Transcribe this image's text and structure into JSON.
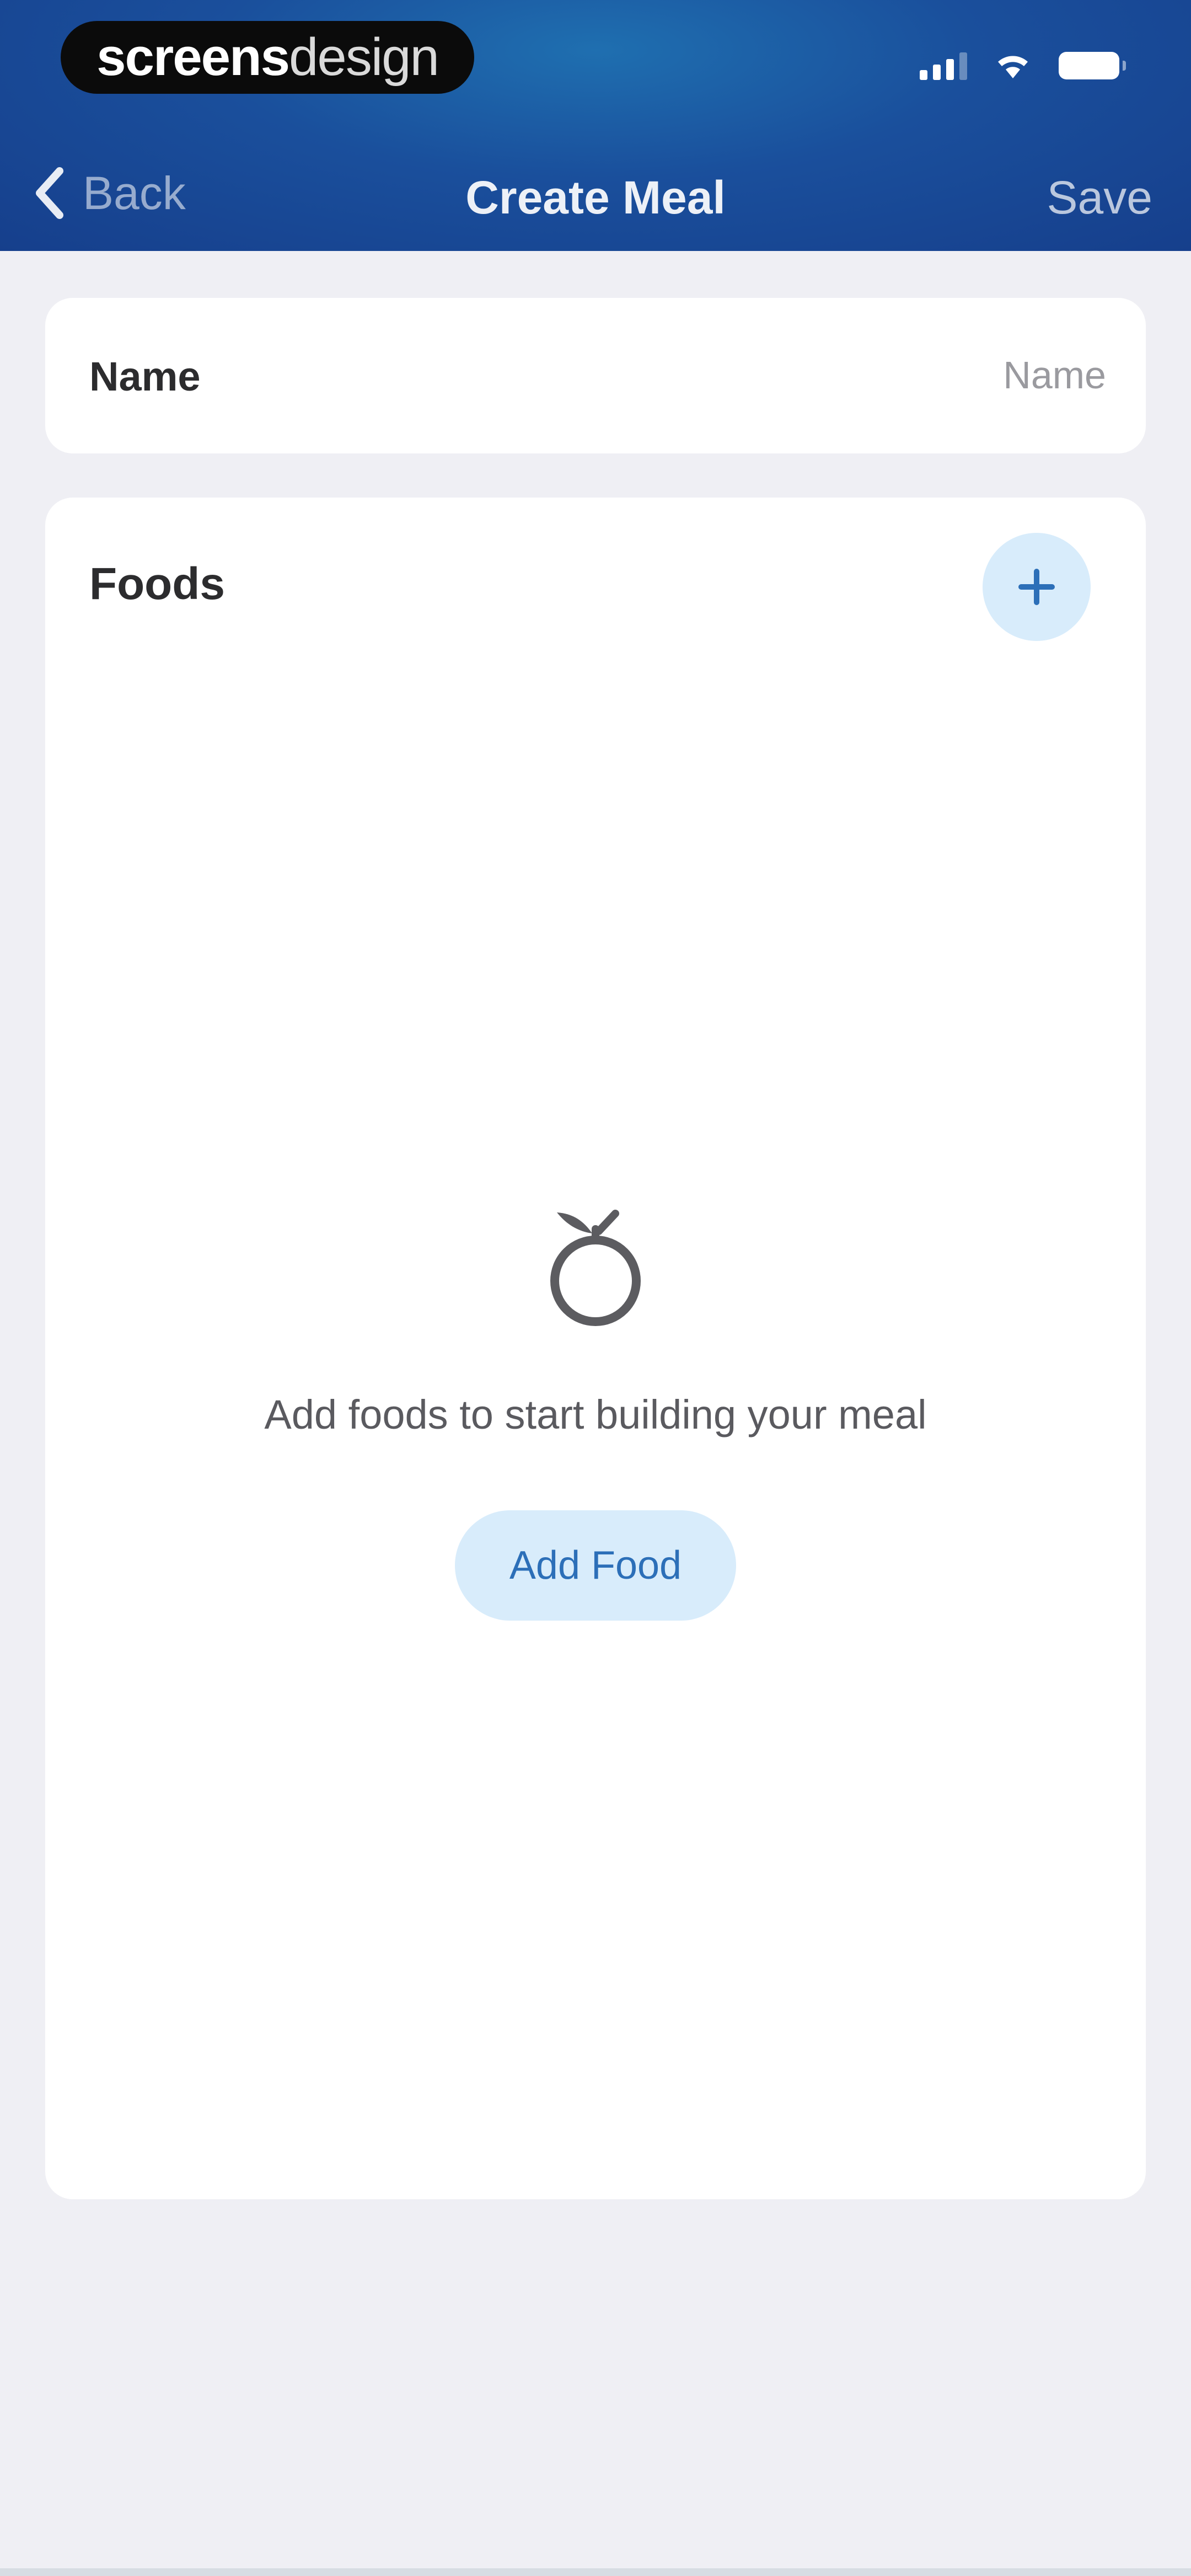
{
  "status_bar": {
    "brand_bold": "screens",
    "brand_light": "design"
  },
  "nav": {
    "back_label": "Back",
    "title": "Create Meal",
    "save_label": "Save"
  },
  "name_field": {
    "label": "Name",
    "placeholder": "Name",
    "value": ""
  },
  "foods": {
    "title": "Foods",
    "empty_message": "Add foods to start building your meal",
    "add_food_label": "Add Food"
  },
  "icons": {
    "back": "chevron-left-icon",
    "add": "plus-icon",
    "empty": "apple-icon",
    "signal": "cellular-signal-icon",
    "wifi": "wifi-icon",
    "battery": "battery-icon"
  },
  "colors": {
    "header_start": "#1f6fb0",
    "header_end": "#163f8c",
    "accent": "#2c6fb8",
    "accent_light": "#d8ecfb",
    "background": "#efeff4",
    "card": "#ffffff"
  }
}
